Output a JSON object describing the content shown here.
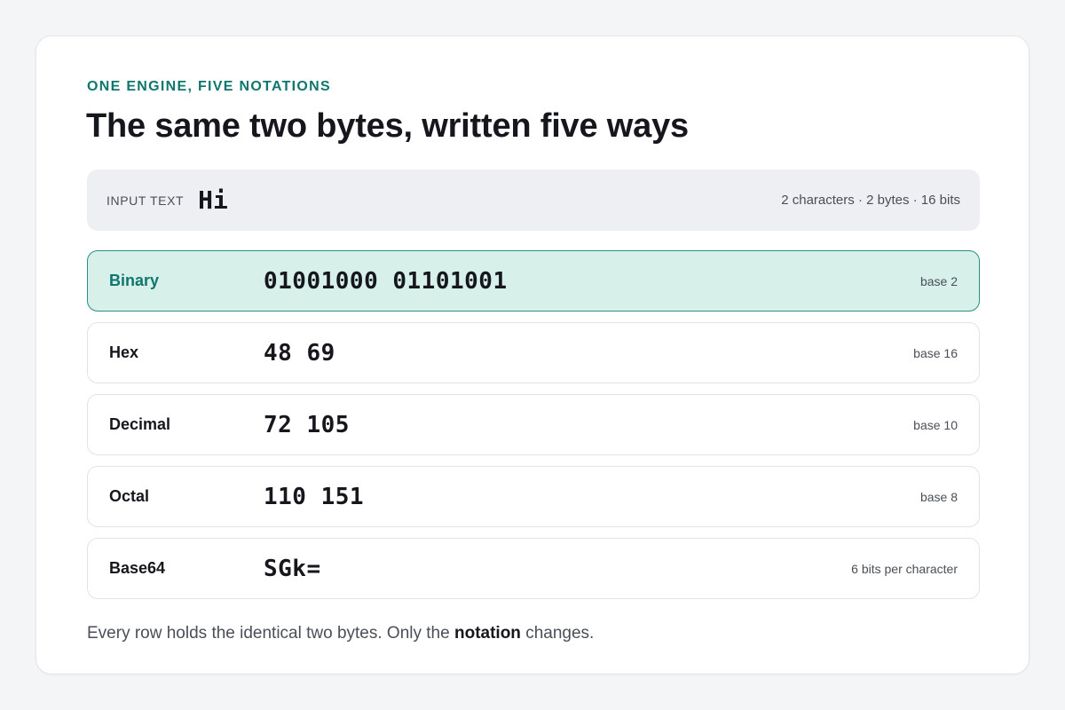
{
  "header": {
    "eyebrow": "ONE ENGINE, FIVE NOTATIONS",
    "title": "The same two bytes, written five ways"
  },
  "input": {
    "label": "INPUT TEXT",
    "value": "Hi",
    "stats": "2 characters · 2 bytes · 16 bits"
  },
  "notations": [
    {
      "label": "Binary",
      "value": "01001000 01101001",
      "base": "base 2",
      "active": true
    },
    {
      "label": "Hex",
      "value": "48 69",
      "base": "base 16",
      "active": false
    },
    {
      "label": "Decimal",
      "value": "72 105",
      "base": "base 10",
      "active": false
    },
    {
      "label": "Octal",
      "value": "110 151",
      "base": "base 8",
      "active": false
    },
    {
      "label": "Base64",
      "value": "SGk=",
      "base": "6 bits per character",
      "active": false
    }
  ],
  "footer": {
    "before": "Every row holds the identical two bytes. Only the ",
    "emphasis": "notation",
    "after": " changes."
  },
  "colors": {
    "accent": "#0f766e",
    "active_row_bg": "#d7f0ea",
    "active_row_border": "#2a8f80",
    "page_bg": "#f4f5f7"
  }
}
